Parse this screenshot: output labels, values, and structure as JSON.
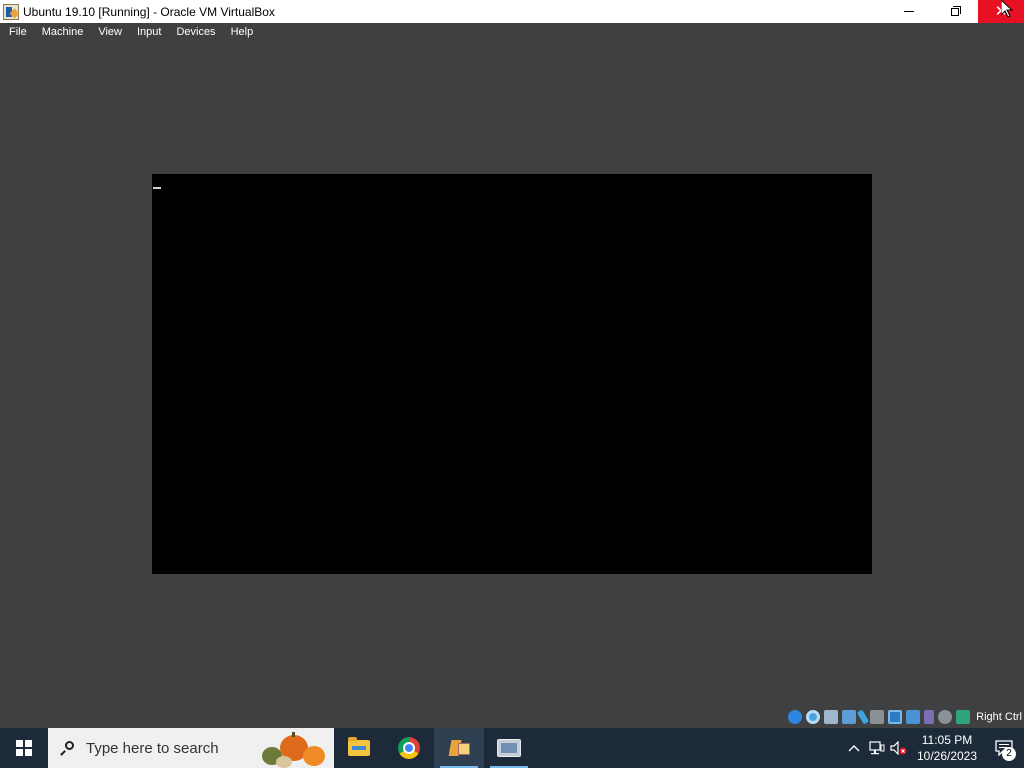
{
  "window": {
    "title": "Ubuntu 19.10 [Running] - Oracle VM VirtualBox",
    "close_glyph": "✕"
  },
  "menu": {
    "items": [
      {
        "label": "File"
      },
      {
        "label": "Machine"
      },
      {
        "label": "View"
      },
      {
        "label": "Input"
      },
      {
        "label": "Devices"
      },
      {
        "label": "Help"
      }
    ]
  },
  "status_bar": {
    "icons": [
      "hard-disk-icon",
      "optical-drive-icon",
      "audio-icon",
      "network-icon",
      "usb-icon",
      "shared-folders-icon",
      "display-icon",
      "video-capture-icon",
      "cpu-icon",
      "mouse-integration-icon",
      "keyboard-icon"
    ],
    "host_key": "Right Ctrl"
  },
  "taskbar": {
    "search_placeholder": "Type here to search",
    "apps": [
      "file-explorer-icon",
      "chrome-icon",
      "virtualbox-icon",
      "vm-window-icon"
    ],
    "time": "11:05 PM",
    "date": "10/26/2023",
    "notification_count": "2"
  },
  "colors": {
    "window_bg": "#3f4042",
    "close_button": "#e81123",
    "taskbar_bg": "#1c2a3a",
    "vm_screen": "#000000"
  }
}
